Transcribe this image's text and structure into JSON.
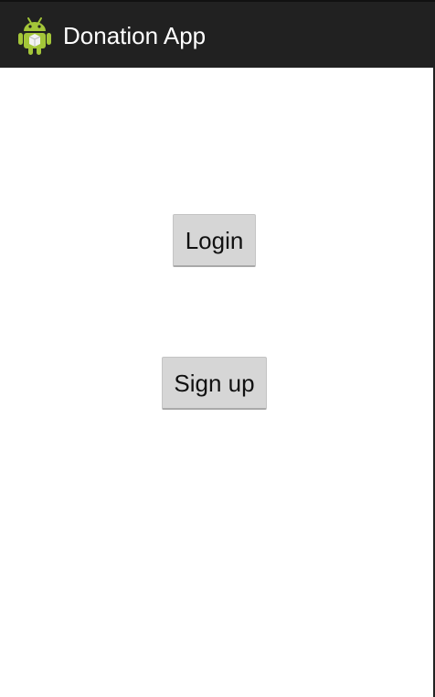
{
  "action_bar": {
    "title": "Donation App",
    "icon": "android-robot-icon",
    "background": "#212121"
  },
  "main": {
    "login_label": "Login",
    "signup_label": "Sign up",
    "button_background": "#d6d6d6"
  }
}
